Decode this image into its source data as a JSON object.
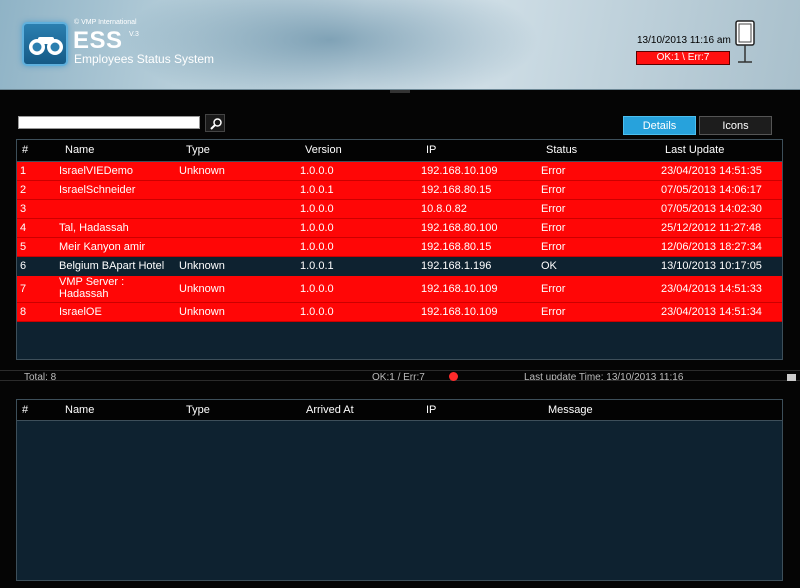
{
  "header": {
    "vendor": "© VMP International",
    "app_name": "ESS",
    "version": "V.3",
    "subtitle": "Employees Status System",
    "datetime": "13/10/2013 11:16 am",
    "status_summary": "OK:1 \\ Err:7"
  },
  "search": {
    "value": "",
    "placeholder": ""
  },
  "tabs": {
    "details": "Details",
    "icons": "Icons"
  },
  "devices_table": {
    "columns": [
      "#",
      "Name",
      "Type",
      "Version",
      "IP",
      "Status",
      "Last Update"
    ],
    "rows": [
      {
        "num": "1",
        "name": "IsraelVIEDemo",
        "type": "Unknown",
        "version": "1.0.0.0",
        "ip": "192.168.10.109",
        "status": "Error",
        "updated": "23/04/2013 14:51:35"
      },
      {
        "num": "2",
        "name": "IsraelSchneider",
        "type": "",
        "version": "1.0.0.1",
        "ip": "192.168.80.15",
        "status": "Error",
        "updated": "07/05/2013 14:06:17"
      },
      {
        "num": "3",
        "name": "",
        "type": "",
        "version": "1.0.0.0",
        "ip": "10.8.0.82",
        "status": "Error",
        "updated": "07/05/2013 14:02:30"
      },
      {
        "num": "4",
        "name": "Tal, Hadassah",
        "type": "",
        "version": "1.0.0.0",
        "ip": "192.168.80.100",
        "status": "Error",
        "updated": "25/12/2012 11:27:48"
      },
      {
        "num": "5",
        "name": "Meir Kanyon amir",
        "type": "",
        "version": "1.0.0.0",
        "ip": "192.168.80.15",
        "status": "Error",
        "updated": "12/06/2013 18:27:34"
      },
      {
        "num": "6",
        "name": "Belgium BApart Hotel",
        "type": "Unknown",
        "version": "1.0.0.1",
        "ip": "192.168.1.196",
        "status": "OK",
        "updated": "13/10/2013 10:17:05"
      },
      {
        "num": "7",
        "name": "VMP Server :",
        "name2": "Hadassah",
        "type": "Unknown",
        "version": "1.0.0.0",
        "ip": "192.168.10.109",
        "status": "Error",
        "updated": "23/04/2013 14:51:33"
      },
      {
        "num": "8",
        "name": "IsraelOE",
        "type": "Unknown",
        "version": "1.0.0.0",
        "ip": "192.168.10.109",
        "status": "Error",
        "updated": "23/04/2013 14:51:34"
      }
    ]
  },
  "status_bar": {
    "total": "Total: 8",
    "counts": "OK:1 / Err:7",
    "last_update": "Last update Time: 13/10/2013 11:16"
  },
  "messages_table": {
    "columns": [
      "#",
      "Name",
      "Type",
      "Arrived At",
      "IP",
      "Message"
    ]
  },
  "colors": {
    "error_row": "#ff0606",
    "ok_row": "#0e2230",
    "accent": "#27a2dc"
  }
}
